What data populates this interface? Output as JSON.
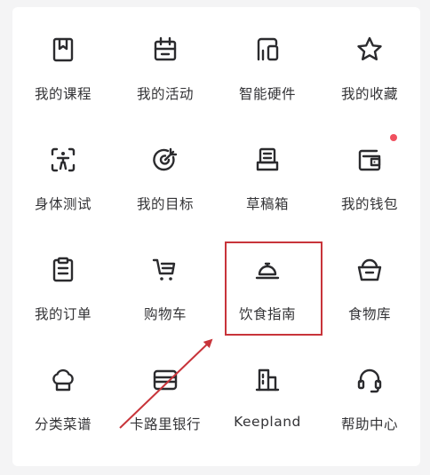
{
  "menu": {
    "items": [
      {
        "label": "我的课程",
        "icon": "bookmark-book-icon"
      },
      {
        "label": "我的活动",
        "icon": "calendar-activity-icon"
      },
      {
        "label": "智能硬件",
        "icon": "smart-hardware-icon"
      },
      {
        "label": "我的收藏",
        "icon": "star-icon"
      },
      {
        "label": "身体测试",
        "icon": "body-scan-icon"
      },
      {
        "label": "我的目标",
        "icon": "target-icon"
      },
      {
        "label": "草稿箱",
        "icon": "drafts-printer-icon"
      },
      {
        "label": "我的钱包",
        "icon": "wallet-icon",
        "badge": true
      },
      {
        "label": "我的订单",
        "icon": "clipboard-order-icon"
      },
      {
        "label": "购物车",
        "icon": "shopping-cart-icon"
      },
      {
        "label": "饮食指南",
        "icon": "food-cloche-icon",
        "highlighted": true
      },
      {
        "label": "食物库",
        "icon": "food-basket-icon"
      },
      {
        "label": "分类菜谱",
        "icon": "chef-hat-icon"
      },
      {
        "label": "卡路里银行",
        "icon": "card-bank-icon"
      },
      {
        "label": "Keepland",
        "icon": "building-icon"
      },
      {
        "label": "帮助中心",
        "icon": "headset-icon"
      }
    ]
  },
  "colors": {
    "icon": "#2b2b2e",
    "badge": "#f0505f",
    "annotation": "#c8343a"
  }
}
